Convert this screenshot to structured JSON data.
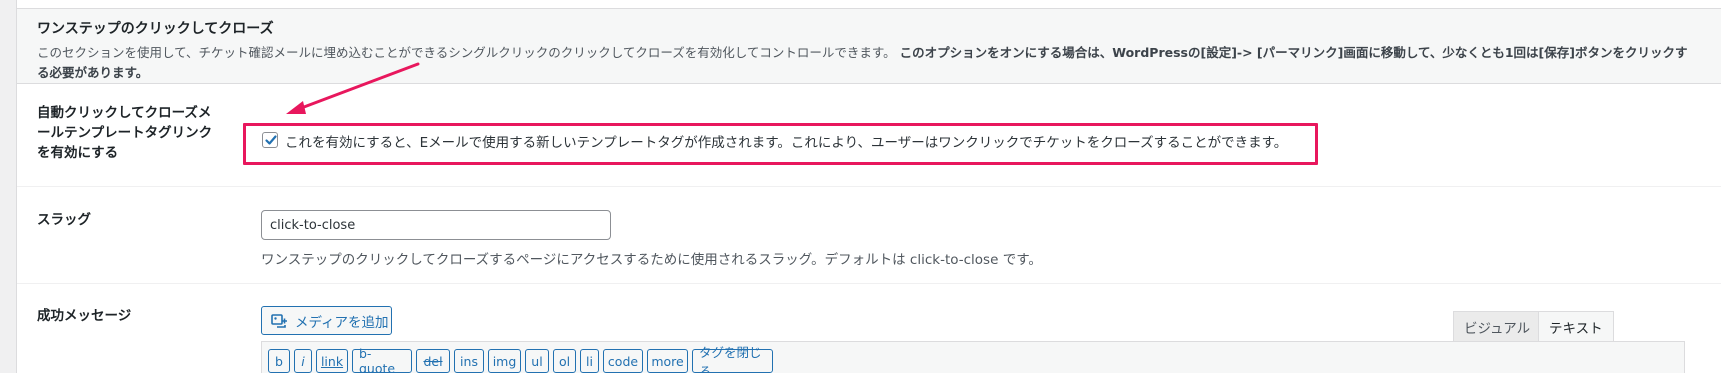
{
  "section": {
    "title": "ワンステップのクリックしてクローズ",
    "description": "このセクションを使用して、チケット確認メールに埋め込むことができるシングルクリックのクリックしてクローズを有効化してコントロールできます。",
    "description_bold": "このオプションをオンにする場合は、WordPressの[設定]-> [パーマリンク]画面に移動して、少なくとも1回は[保存]ボタンをクリックする必要があります。"
  },
  "enable_row": {
    "label": "自動クリックしてクローズメールテンプレートタグリンクを有効にする",
    "checkbox_checked": true,
    "checkbox_label": "これを有効にすると、Eメールで使用する新しいテンプレートタグが作成されます。これにより、ユーザーはワンクリックでチケットをクローズすることができます。"
  },
  "slug_row": {
    "label": "スラッグ",
    "value": "click-to-close",
    "description": "ワンステップのクリックしてクローズするページにアクセスするために使用されるスラッグ。デフォルトは click-to-close です。"
  },
  "success_row": {
    "label": "成功メッセージ",
    "media_button": "メディアを追加",
    "tabs": [
      "ビジュアル",
      "テキスト"
    ],
    "quicktags": [
      "b",
      "i",
      "link",
      "b-quote",
      "del",
      "ins",
      "img",
      "ul",
      "ol",
      "li",
      "code",
      "more",
      "タグを閉じる"
    ]
  },
  "colors": {
    "highlight": "#e8175d",
    "accent": "#2271b1"
  },
  "icons": {
    "checkbox": "checkmark-icon",
    "media": "media-add-icon",
    "annotation": "arrow-icon"
  }
}
